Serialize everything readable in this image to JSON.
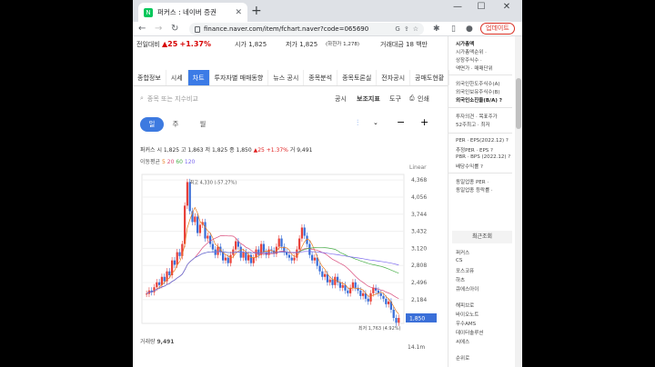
{
  "browser": {
    "tab_title": "퍼커스 : 네이버 증권",
    "new_tab": "+",
    "minimize": "—",
    "maximize": "☐",
    "close": "✕",
    "back": "←",
    "forward": "→",
    "reload": "↻",
    "url": "finance.naver.com/item/fchart.naver?code=065690",
    "update_label": "업데이트",
    "favicon": "N"
  },
  "price_line": {
    "change_label": "전일대비",
    "change_value": "▲25",
    "change_pct": "+1.37%",
    "open": "시가 1,825",
    "low": "저가 1,825",
    "low_limit": "(하한가 1,278)",
    "amount": "거래대금 18 백만"
  },
  "section_tabs": [
    "종합정보",
    "시세",
    "차트",
    "투자자별 매매동향",
    "뉴스 공시",
    "종목분석",
    "종목토론실",
    "전자공시",
    "공매도현황"
  ],
  "section_tab_active": 2,
  "toolbar": {
    "search_placeholder": "종목 또는 지수비교",
    "disclosure": "공시",
    "aux_indicator": "보조지표",
    "tools": "도구",
    "print": "인쇄"
  },
  "periods": [
    "일",
    "주",
    "월"
  ],
  "period_active": 0,
  "quote": {
    "name": "퍼커스",
    "open": "시 1,825",
    "high": "고 1,863",
    "low": "저 1,825",
    "close": "종 1,850",
    "change": "▲25 +1.37%",
    "volume": "거 9,491"
  },
  "ma": {
    "label": "이동평균",
    "p5": "5",
    "p20": "20",
    "p60": "60",
    "p120": "120"
  },
  "scale_label": "Linear",
  "volume_label": "거래량",
  "volume_value": "9,491",
  "volume_max": "14.1m",
  "chart_data": {
    "type": "candlestick",
    "y_ticks": [
      4368,
      4056,
      3744,
      3432,
      3120,
      2808,
      2496,
      2184
    ],
    "ylim": [
      1750,
      4470
    ],
    "current_price": "1,850",
    "max_label": "최고 4,330 (-57.27%)",
    "min_label": "최저 1,763 (4.92%)",
    "close": [
      2290,
      2350,
      2320,
      2410,
      2500,
      2450,
      2600,
      2520,
      2700,
      2630,
      2900,
      2820,
      3050,
      2980,
      3200,
      3900,
      4330,
      3800,
      3600,
      3700,
      3400,
      3550,
      3600,
      3300,
      3350,
      3200,
      3100,
      3000,
      3150,
      3050,
      2900,
      2950,
      2850,
      3000,
      3100,
      3250,
      3150,
      2950,
      3050,
      2900,
      3000,
      2850,
      2950,
      3100,
      3000,
      3200,
      3050,
      3000,
      3100,
      3080,
      3020,
      3150,
      3300,
      3150,
      3050,
      3000,
      2950,
      2900,
      2950,
      3100,
      3300,
      3500,
      3350,
      3200,
      3000,
      2900,
      2950,
      2800,
      2700,
      2600,
      2650,
      2500,
      2550,
      2450,
      2600,
      2500,
      2400,
      2450,
      2350,
      2300,
      2400,
      2500,
      2400,
      2350,
      2250,
      2300,
      2200,
      2150,
      2300,
      2400,
      2350,
      2300,
      2250,
      2200,
      2100,
      2150,
      2000,
      1850,
      1763,
      1850
    ]
  }
}
